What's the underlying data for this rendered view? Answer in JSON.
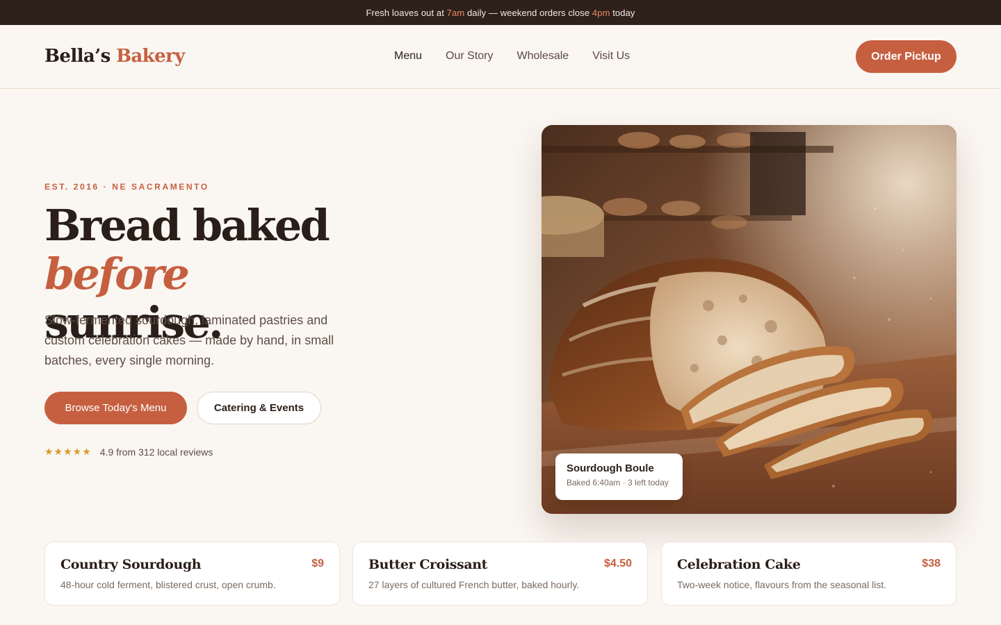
{
  "announcement": {
    "part1": "Fresh loaves out at ",
    "time1": "7am",
    "part2": " daily — weekend orders close ",
    "time2": "4pm",
    "part3": " today"
  },
  "header": {
    "logo_main": "Bella’s ",
    "logo_accent": "Bakery",
    "nav": [
      "Menu",
      "Our Story",
      "Wholesale",
      "Visit Us"
    ],
    "active_nav": "Menu",
    "cta": "Order Pickup"
  },
  "hero": {
    "eyebrow": "EST. 2016 · NE SACRAMENTO",
    "headline_part1": "Bread baked ",
    "headline_em": "before",
    "headline_part2": "sunrise.",
    "subtext": "Slow-fermented sourdough, laminated pastries and custom celebration cakes — made by hand, in small batches, every single morning.",
    "primary_button": "Browse Today's Menu",
    "secondary_button": "Catering & Events",
    "stars": "★★★★★",
    "rating_text": "4.9 from 312 local reviews"
  },
  "feature_image": {
    "card_title": "Sourdough Boule",
    "card_subtitle": "Baked 6:40am · 3 left today"
  },
  "products": [
    {
      "name": "Country Sourdough",
      "price": "$9",
      "description": "48-hour cold ferment, blistered crust, open crumb."
    },
    {
      "name": "Butter Croissant",
      "price": "$4.50",
      "description": "27 layers of cultured French butter, baked hourly."
    },
    {
      "name": "Celebration Cake",
      "price": "$38",
      "description": "Two-week notice, flavours from the seasonal list."
    }
  ],
  "colors": {
    "accent": "#c65f40",
    "topbar_bg": "#2e211b",
    "page_bg": "#faf6f1",
    "star": "#d99a2b"
  }
}
